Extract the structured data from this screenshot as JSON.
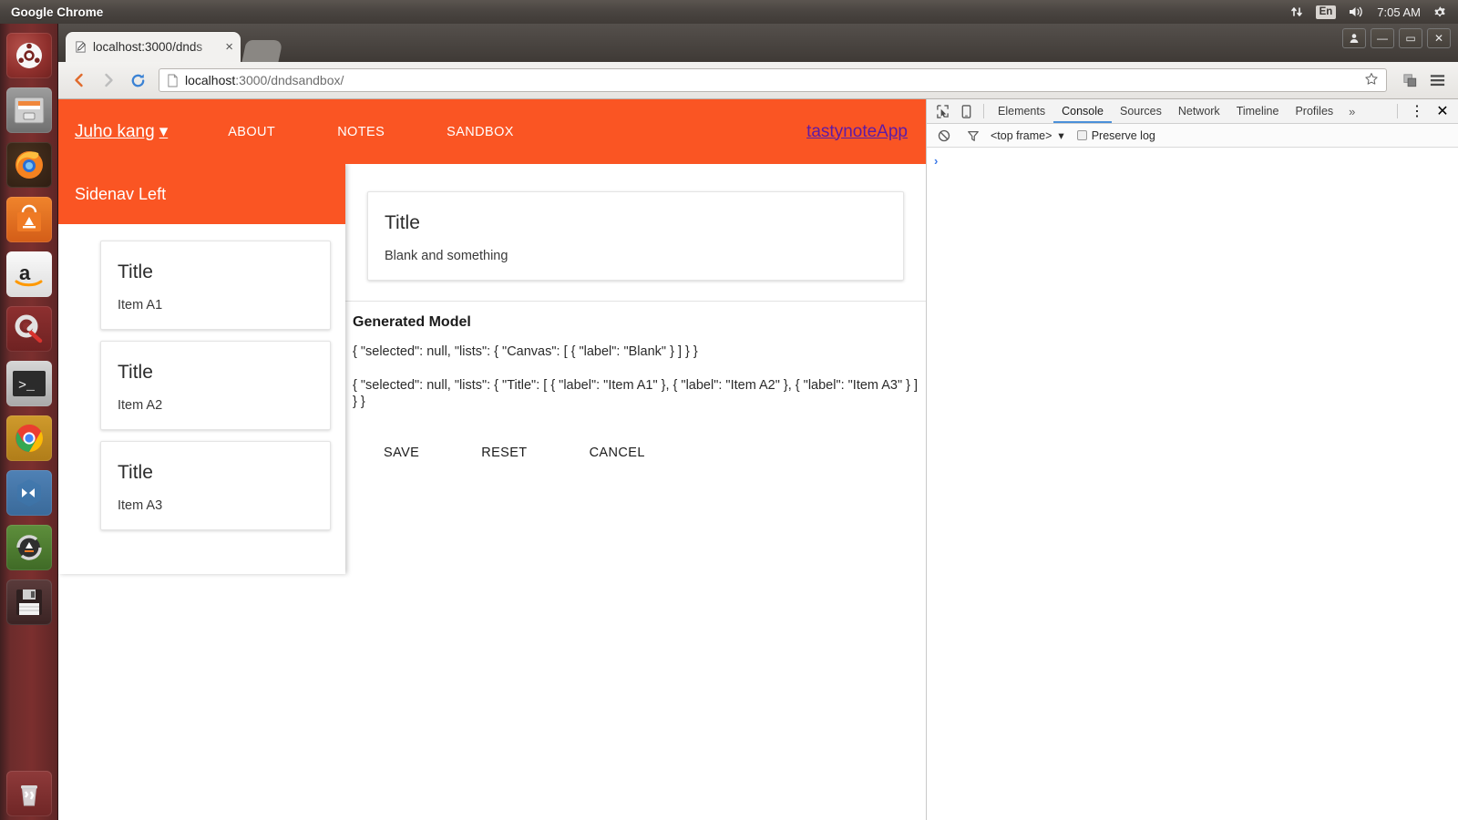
{
  "desktop": {
    "panel": {
      "app_name": "Google Chrome",
      "tray": {
        "network_icon": "network-updown-icon",
        "keyboard_layout": "En",
        "volume_icon": "volume-icon",
        "clock": "7:05 AM",
        "settings_icon": "system-gear-icon"
      }
    },
    "launcher": {
      "items": [
        {
          "name": "dash-home",
          "icon": "ubuntu-logo-icon",
          "glyph": "●",
          "running": false,
          "focused": false
        },
        {
          "name": "files",
          "icon": "file-cabinet-icon",
          "glyph": "☰",
          "running": false,
          "focused": false
        },
        {
          "name": "firefox",
          "icon": "firefox-icon",
          "glyph": "🦊",
          "running": false,
          "focused": false
        },
        {
          "name": "ubuntu-software",
          "icon": "software-center-icon",
          "glyph": "A",
          "running": false,
          "focused": false
        },
        {
          "name": "amazon",
          "icon": "amazon-icon",
          "glyph": "a",
          "running": false,
          "focused": false
        },
        {
          "name": "system-settings",
          "icon": "gear-wrench-icon",
          "glyph": "⚙",
          "running": false,
          "focused": false
        },
        {
          "name": "terminal",
          "icon": "terminal-icon",
          "glyph": ">_",
          "running": true,
          "focused": false
        },
        {
          "name": "google-chrome",
          "icon": "chrome-icon",
          "glyph": "◉",
          "running": true,
          "focused": true
        },
        {
          "name": "visual-studio-code",
          "icon": "vscode-icon",
          "glyph": "⊳⊲",
          "running": true,
          "focused": false
        },
        {
          "name": "software-updater",
          "icon": "software-updater-icon",
          "glyph": "↻",
          "running": true,
          "focused": false
        },
        {
          "name": "save-disk",
          "icon": "floppy-disk-icon",
          "glyph": "💾",
          "running": false,
          "focused": false
        },
        {
          "name": "trash",
          "icon": "trash-icon",
          "glyph": "🗑",
          "running": false,
          "focused": false
        }
      ]
    }
  },
  "browser": {
    "tab": {
      "title": "localhost:3000/dnds",
      "favicon": "pencil-page-icon",
      "close_label": "×"
    },
    "new_tab_label": "",
    "window_controls": {
      "profile": "👤",
      "minimize": "—",
      "maximize": "▭",
      "close": "✕"
    },
    "toolbar": {
      "back": "‹",
      "forward": "›",
      "reload": "↻",
      "page_icon": "page-document-icon",
      "url_host": "localhost",
      "url_rest": ":3000/dndsandbox/",
      "bookmark_star": "☆",
      "extension_icon": "extension-cubes-icon",
      "menu_icon": "☰"
    }
  },
  "page": {
    "accent_color": "#fa5523",
    "link_color": "#5c1ba6",
    "appbar": {
      "brand": "Juho kang",
      "brand_caret": "▾",
      "nav": [
        {
          "label": "ABOUT"
        },
        {
          "label": "NOTES"
        },
        {
          "label": "SANDBOX"
        }
      ],
      "app_link": "tastynoteApp"
    },
    "sidenav": {
      "header": "Sidenav Left",
      "cards": [
        {
          "title": "Title",
          "text": "Item A1"
        },
        {
          "title": "Title",
          "text": "Item A2"
        },
        {
          "title": "Title",
          "text": "Item A3"
        }
      ]
    },
    "canvas": {
      "card": {
        "title": "Title",
        "text": "Blank and something"
      }
    },
    "generated_model": {
      "heading": "Generated Model",
      "lines": [
        "{ \"selected\": null, \"lists\": { \"Canvas\": [ { \"label\": \"Blank\" } ] } }",
        "{ \"selected\": null, \"lists\": { \"Title\": [ { \"label\": \"Item A1\" }, { \"label\": \"Item A2\" }, { \"label\": \"Item A3\" } ] } }"
      ]
    },
    "actions": [
      {
        "label": "SAVE",
        "name": "save-button"
      },
      {
        "label": "RESET",
        "name": "reset-button"
      },
      {
        "label": "CANCEL",
        "name": "cancel-button"
      }
    ]
  },
  "devtools": {
    "inspect_icon": "inspect-cursor-icon",
    "device_icon": "device-toolbar-icon",
    "tabs": [
      {
        "label": "Elements",
        "active": false
      },
      {
        "label": "Console",
        "active": true
      },
      {
        "label": "Sources",
        "active": false
      },
      {
        "label": "Network",
        "active": false
      },
      {
        "label": "Timeline",
        "active": false
      },
      {
        "label": "Profiles",
        "active": false
      }
    ],
    "more_tabs": "»",
    "menu_icon": "⋮",
    "close_icon": "✕",
    "filterbar": {
      "clear_icon": "clear-console-icon",
      "filter_icon": "filter-funnel-icon",
      "frame_selector": "<top frame>",
      "frame_caret": "▾",
      "preserve_log_label": "Preserve log",
      "preserve_log_checked": false
    },
    "console": {
      "prompt": "›"
    }
  }
}
